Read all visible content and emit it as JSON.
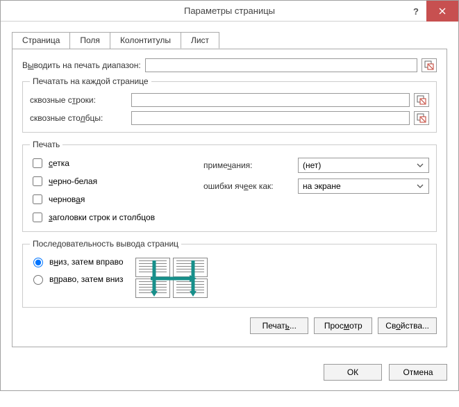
{
  "title": "Параметры страницы",
  "tabs": {
    "page": "Страница",
    "fields": "Поля",
    "headers": "Колонтитулы",
    "sheet": "Лист"
  },
  "printArea": {
    "label": "Выводить на печать диапазон:",
    "value": ""
  },
  "repeat": {
    "legend": "Печатать на каждой странице",
    "rowsLabel": "сквозные строки:",
    "rowsValue": "",
    "colsLabel": "сквозные столбцы:",
    "colsValue": ""
  },
  "print": {
    "legend": "Печать",
    "grid": "сетка",
    "bw": "черно-белая",
    "draft": "черновая",
    "headings": "заголовки строк и столбцов",
    "notesLabel": "примечания:",
    "notesValue": "(нет)",
    "errorsLabel": "ошибки ячеек как:",
    "errorsValue": "на экране"
  },
  "order": {
    "legend": "Последовательность вывода страниц",
    "downThenOver": "вниз, затем вправо",
    "overThenDown": "вправо, затем вниз"
  },
  "buttons": {
    "print": "Печать...",
    "preview": "Просмотр",
    "properties": "Свойства...",
    "ok": "ОК",
    "cancel": "Отмена"
  }
}
